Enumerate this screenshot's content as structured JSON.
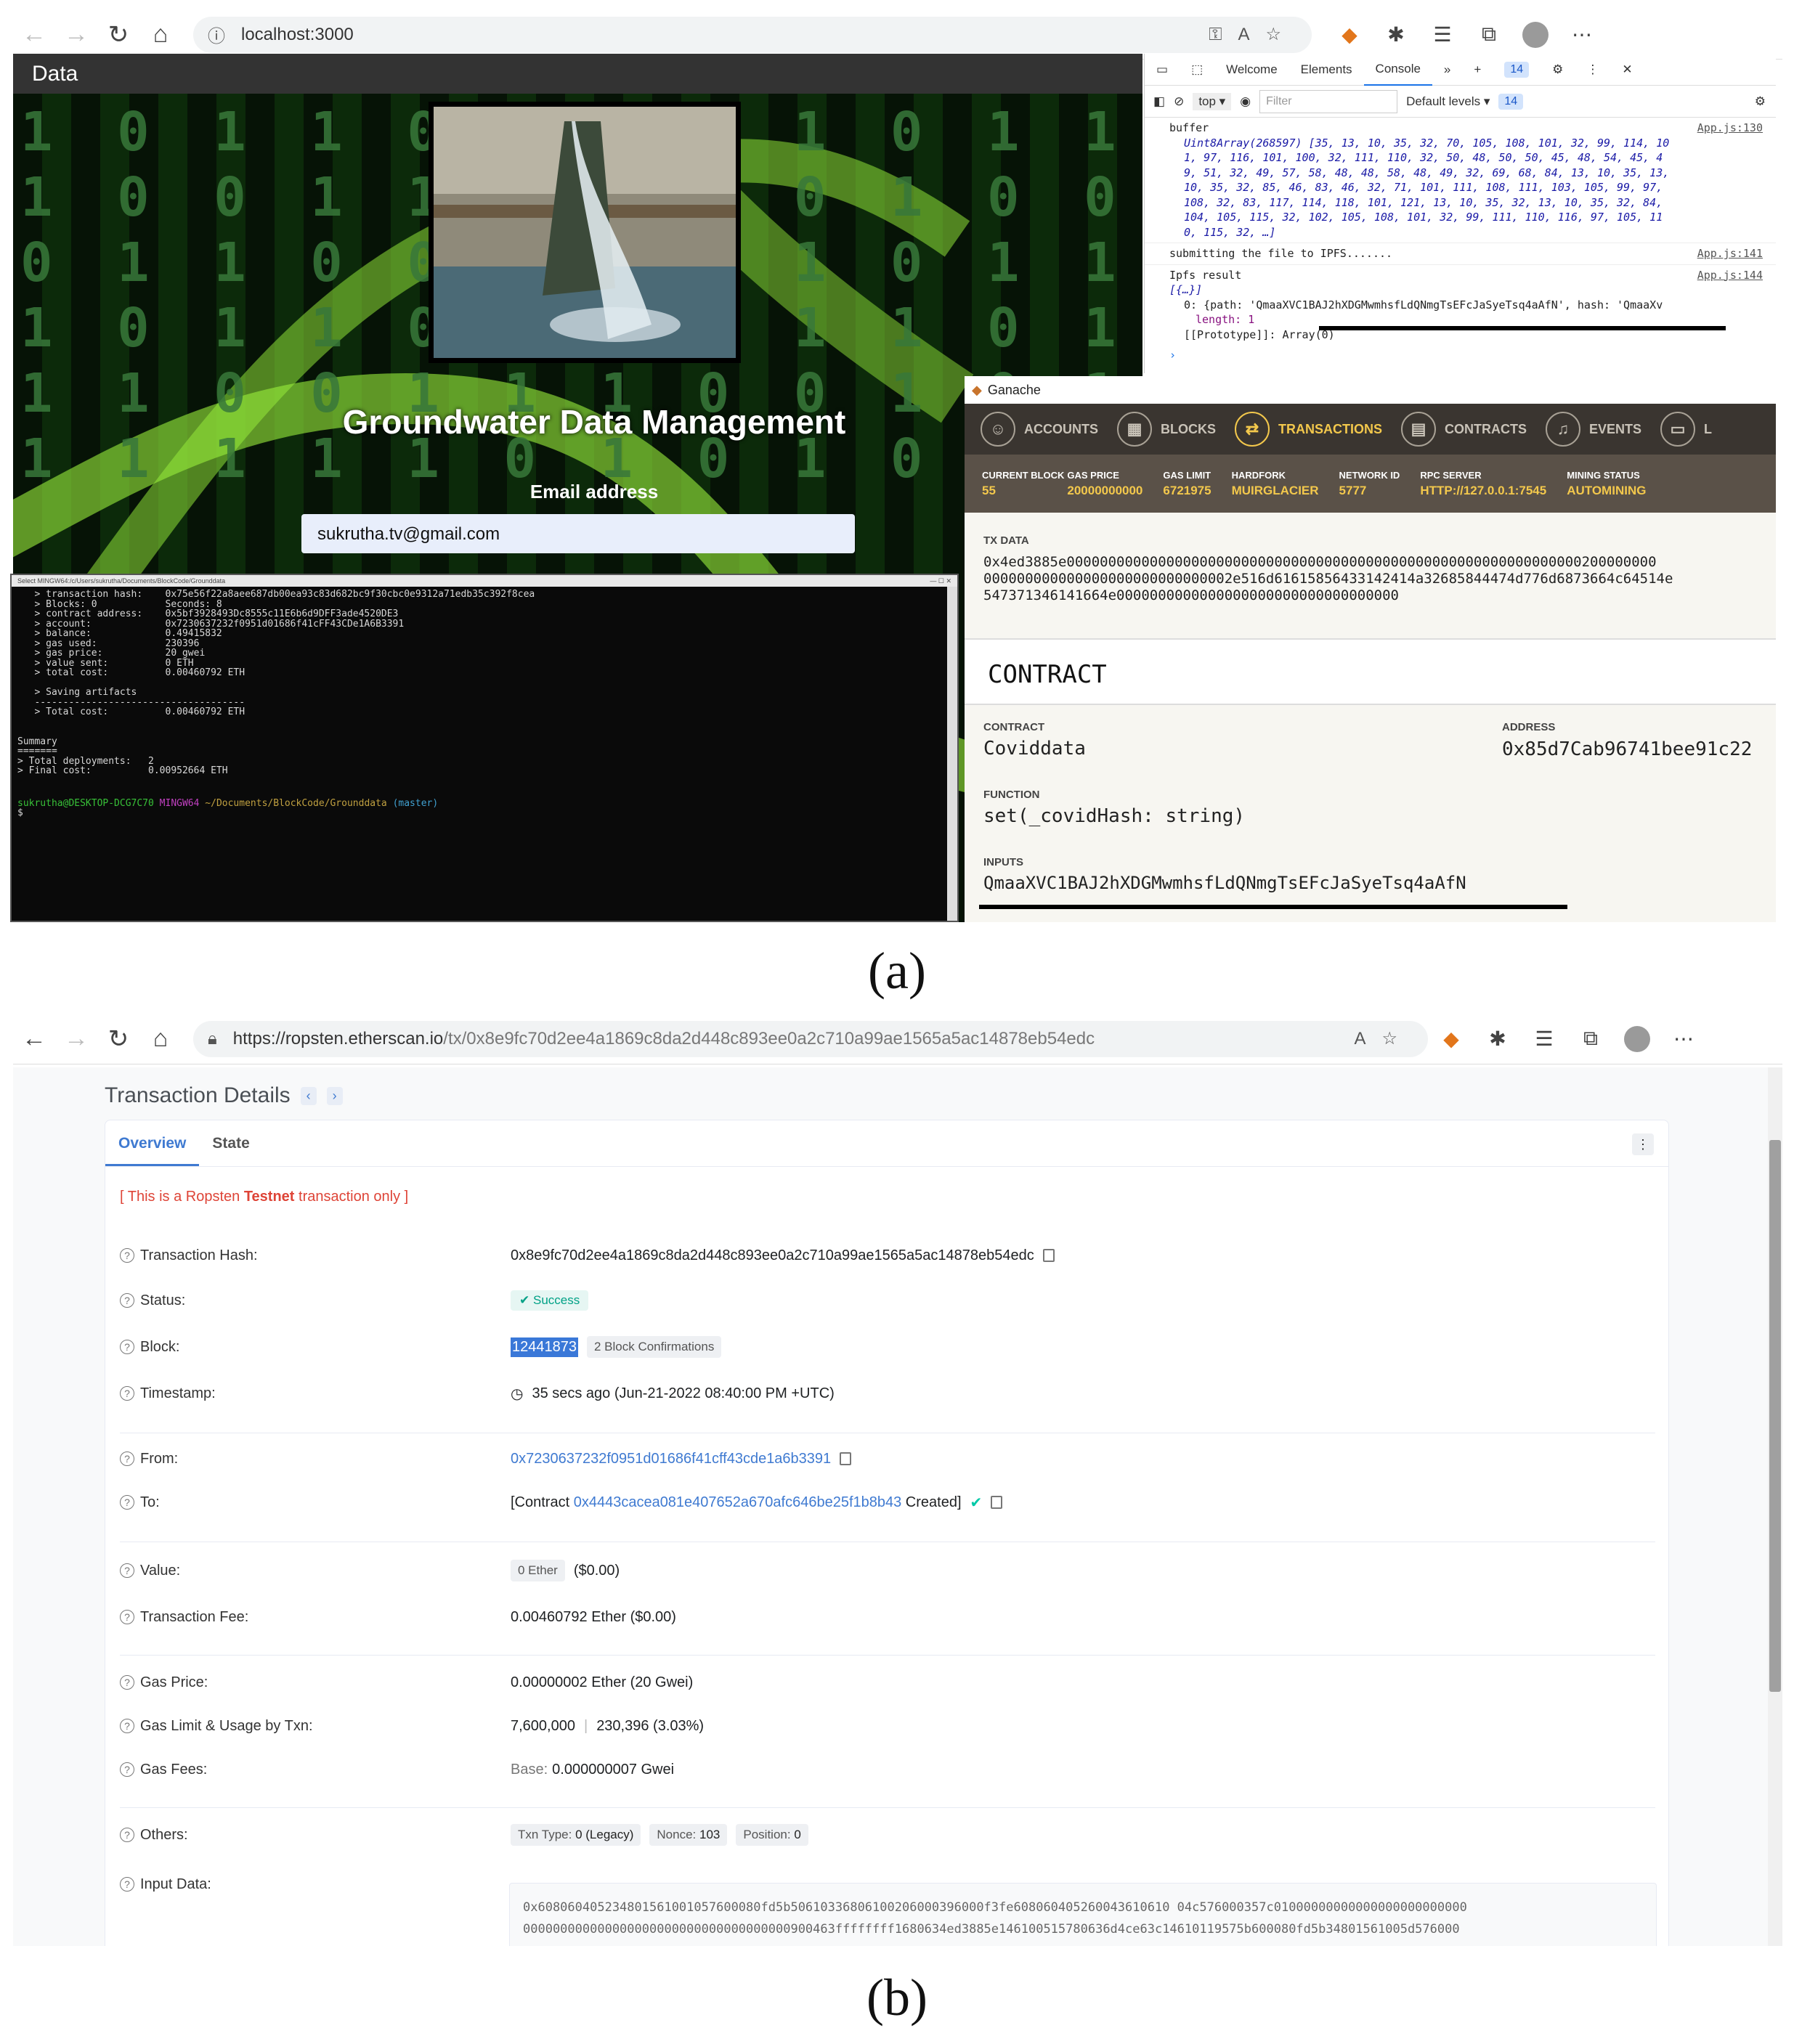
{
  "captions": {
    "a": "(a)",
    "b": "(b)"
  },
  "browser_a": {
    "url": "localhost:3000"
  },
  "app": {
    "bar_title": "Data",
    "title": "Groundwater Data Management",
    "email_label": "Email address",
    "email_value": "sukrutha.tv@gmail.com"
  },
  "terminal": {
    "title": "Select MINGW64:/c/Users/sukrutha/Documents/BlockCode/Grounddata",
    "lines": [
      "   > transaction hash:    0x75e56f22a8aee687db00ea93c83d682bc9f30cbc0e9312a71edb35c392f8cea",
      "   > Blocks: 0            Seconds: 8",
      "   > contract address:    0x5bf3928493Dc8555c11E6b6d9DFF3ade4520DE3",
      "   > account:             0x7230637232f0951d01686f41cFF43CDe1A6B3391",
      "   > balance:             0.49415832",
      "   > gas used:            230396",
      "   > gas price:           20 gwei",
      "   > value sent:          0 ETH",
      "   > total cost:          0.00460792 ETH",
      "",
      "   > Saving artifacts",
      "   -------------------------------------",
      "   > Total cost:          0.00460792 ETH",
      "",
      "",
      "Summary",
      "=======",
      "> Total deployments:   2",
      "> Final cost:          0.00952664 ETH",
      "",
      ""
    ],
    "prompt_user": "sukrutha@DESKTOP-DCG7C70",
    "prompt_shell": "MINGW64",
    "prompt_path": "~/Documents/BlockCode/Grounddata",
    "prompt_branch": "(master)",
    "cursor": "$"
  },
  "devtools": {
    "tabs": [
      "Welcome",
      "Elements",
      "Console"
    ],
    "active_tab": "Console",
    "badge": "14",
    "context": "top",
    "filter_placeholder": "Filter",
    "levels": "Default levels",
    "badge2": "14",
    "log1_label": "buffer",
    "log1_src": "App.js:130",
    "log1_array_lines": [
      "Uint8Array(268597) [35, 13, 10, 35, 32, 70, 105, 108, 101, 32, 99, 114, 10",
      "1, 97, 116, 101, 100, 32, 111, 110, 32, 50, 48, 50, 50, 45, 48, 54, 45, 4",
      "9, 51, 32, 49, 57, 58, 48, 48, 58, 48, 49, 32, 69, 68, 84, 13, 10, 35, 13,",
      "10, 35, 32, 85, 46, 83, 46, 32, 71, 101, 111, 108, 111, 103, 105, 99, 97,",
      "108, 32, 83, 117, 114, 118, 101, 121, 13, 10, 35, 32, 13, 10, 35, 32, 84,",
      "104, 105, 115, 32, 102, 105, 108, 101, 32, 99, 111, 110, 116, 97, 105, 11",
      "0, 115, 32, …]"
    ],
    "log2_text": "submitting the file to IPFS.......",
    "log2_src": "App.js:141",
    "log3_label": "Ipfs result",
    "log3_src": "App.js:144",
    "log3_array": "[{…}]",
    "log3_item": "0: {path: 'QmaaXVC1BAJ2hXDGMwmhsfLdQNmgTsEFcJaSyeTsq4aAfN', hash: 'QmaaXv",
    "log3_length": "length: 1",
    "log3_proto": "[[Prototype]]: Array(0)",
    "prompt": "›"
  },
  "ganache": {
    "title": "Ganache",
    "nav": [
      "ACCOUNTS",
      "BLOCKS",
      "TRANSACTIONS",
      "CONTRACTS",
      "EVENTS",
      "L"
    ],
    "active_nav": "TRANSACTIONS",
    "stats": [
      {
        "k": "CURRENT BLOCK",
        "v": "55"
      },
      {
        "k": "GAS PRICE",
        "v": "20000000000"
      },
      {
        "k": "GAS LIMIT",
        "v": "6721975"
      },
      {
        "k": "HARDFORK",
        "v": "MUIRGLACIER"
      },
      {
        "k": "NETWORK ID",
        "v": "5777"
      },
      {
        "k": "RPC SERVER",
        "v": "HTTP://127.0.0.1:7545"
      },
      {
        "k": "MINING STATUS",
        "v": "AUTOMINING"
      }
    ],
    "tx_data_label": "TX DATA",
    "tx_data_lines": [
      "0x4ed3885e00000000000000000000000000000000000000000000000000000000000000200000000",
      "000000000000000000000000000002e516d61615856433142414a32685844474d776d6873664c64514e",
      "547371346141664e0000000000000000000000000000000000"
    ],
    "contract_heading": "CONTRACT",
    "contract_label": "CONTRACT",
    "contract_value": "Coviddata",
    "address_label": "ADDRESS",
    "address_value": "0x85d7Cab96741bee91c22",
    "function_label": "FUNCTION",
    "function_value": "set(_covidHash: string)",
    "inputs_label": "INPUTS",
    "inputs_value": "QmaaXVC1BAJ2hXDGMwmhsfLdQNmgTsEFcJaSyeTsq4aAfN"
  },
  "browser_b": {
    "url_prefix": "https://ropsten.etherscan.io",
    "url_path": "/tx/0x8e9fc70d2ee4a1869c8da2d448c893ee0a2c710a99ae1565a5ac14878eb54edc"
  },
  "etherscan": {
    "page_title": "Transaction Details",
    "tabs": [
      "Overview",
      "State"
    ],
    "testnet_note_pre": "[ This is a Ropsten ",
    "testnet_note_bold": "Testnet",
    "testnet_note_post": " transaction only ]",
    "rows": {
      "tx_hash": {
        "label": "Transaction Hash:",
        "value": "0x8e9fc70d2ee4a1869c8da2d448c893ee0a2c710a99ae1565a5ac14878eb54edc"
      },
      "status": {
        "label": "Status:",
        "value": "Success"
      },
      "block": {
        "label": "Block:",
        "value": "12441873",
        "confirmations": "2 Block Confirmations"
      },
      "timestamp": {
        "label": "Timestamp:",
        "value": "35 secs ago (Jun-21-2022 08:40:00 PM +UTC)"
      },
      "from": {
        "label": "From:",
        "value": "0x7230637232f0951d01686f41cff43cde1a6b3391"
      },
      "to": {
        "label": "To:",
        "prefix": "[Contract ",
        "value": "0x4443cacea081e407652a670afc646be25f1b8b43",
        "suffix": " Created]"
      },
      "value": {
        "label": "Value:",
        "pill": "0 Ether",
        "usd": "($0.00)"
      },
      "fee": {
        "label": "Transaction Fee:",
        "value": "0.00460792 Ether ($0.00)"
      },
      "gas_price": {
        "label": "Gas Price:",
        "value": "0.00000002 Ether (20 Gwei)"
      },
      "gas_limit": {
        "label": "Gas Limit & Usage by Txn:",
        "limit": "7,600,000",
        "sep": "|",
        "usage": "230,396 (3.03%)"
      },
      "gas_fees": {
        "label": "Gas Fees:",
        "base_label": "Base:",
        "base_value": "0.000000007 Gwei"
      },
      "others": {
        "label": "Others:",
        "txn_type_label": "Txn Type:",
        "txn_type": "0 (Legacy)",
        "nonce_label": "Nonce:",
        "nonce": "103",
        "position_label": "Position:",
        "position": "0"
      },
      "input": {
        "label": "Input Data:",
        "lines": [
          "0x608060405234801561001057600080fd5b50610336806100206000396000f3fe608060405260043610610 04c576000357c01000000000000000000000000",
          "000000000000000000000000000000000000900463ffffffff1680634ed3885e146100515780636d4ce63c14610119575b600080fd5b34801561005d576000"
        ]
      }
    }
  },
  "colors": {
    "ganache_gold": "#f3c84c",
    "etherscan_link": "#3f7ad1",
    "success_green": "#00a186",
    "testnet_red": "#de4437"
  }
}
